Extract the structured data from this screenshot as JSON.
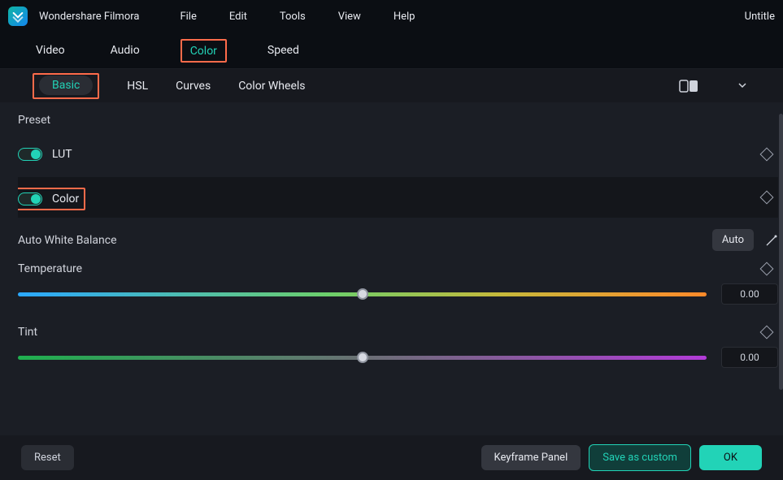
{
  "app": {
    "title": "Wondershare Filmora",
    "doc_title": "Untitle"
  },
  "menubar": {
    "file": "File",
    "edit": "Edit",
    "tools": "Tools",
    "view": "View",
    "help": "Help"
  },
  "main_tabs": {
    "video": "Video",
    "audio": "Audio",
    "color": "Color",
    "speed": "Speed"
  },
  "sub_tabs": {
    "basic": "Basic",
    "hsl": "HSL",
    "curves": "Curves",
    "color_wheels": "Color Wheels"
  },
  "panel": {
    "preset_label": "Preset",
    "lut_label": "LUT",
    "color_label": "Color",
    "awb_label": "Auto White Balance",
    "auto_btn": "Auto",
    "sliders": {
      "temperature": {
        "label": "Temperature",
        "value": "0.00"
      },
      "tint": {
        "label": "Tint",
        "value": "0.00"
      }
    }
  },
  "footer": {
    "reset": "Reset",
    "keyframe_panel": "Keyframe Panel",
    "save_custom": "Save as custom",
    "ok": "OK"
  }
}
